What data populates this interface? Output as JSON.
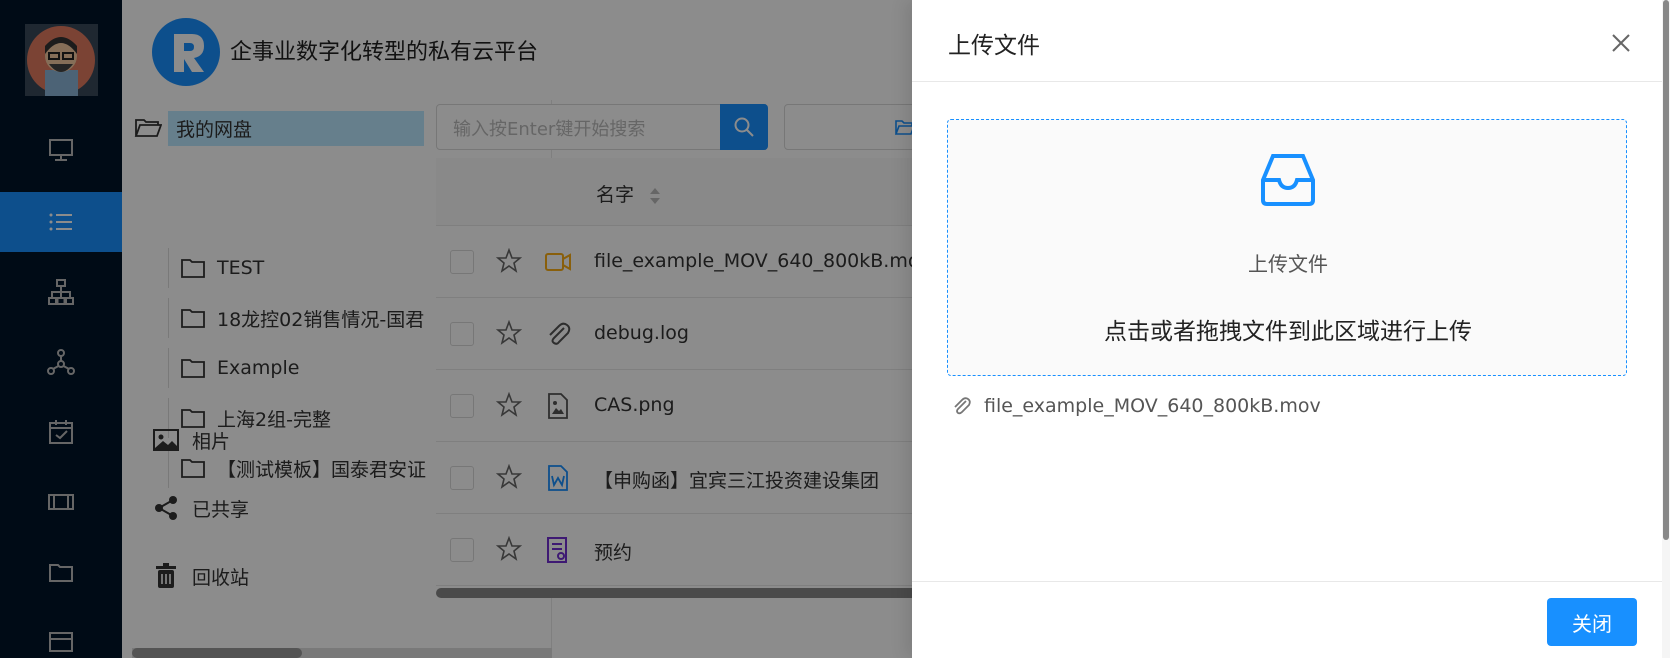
{
  "header": {
    "platform_title": "企事业数字化转型的私有云平台"
  },
  "tree": {
    "root_label": "我的网盘",
    "folders": [
      "TEST",
      "18龙控02销售情况-国君",
      "Example",
      "上海2组-完整",
      "【测试模板】国泰君安证"
    ]
  },
  "side_links": {
    "photos": "相片",
    "shared": "已共享",
    "recycle": "回收站"
  },
  "search": {
    "placeholder": "输入按Enter键开始搜索"
  },
  "table": {
    "name_column": "名字",
    "rows": [
      {
        "name": "file_example_MOV_640_800kB.mov",
        "type": "video"
      },
      {
        "name": "debug.log",
        "type": "attachment"
      },
      {
        "name": "CAS.png",
        "type": "image"
      },
      {
        "name": "【申购函】宜宾三江投资建设集团",
        "type": "word"
      },
      {
        "name": "预约",
        "type": "form"
      }
    ]
  },
  "drawer": {
    "title": "上传文件",
    "dropzone_title": "上传文件",
    "dropzone_hint": "点击或者拖拽文件到此区域进行上传",
    "uploaded_file": "file_example_MOV_640_800kB.mov",
    "close_button": "关闭"
  },
  "colors": {
    "primary": "#1890ff",
    "rail_bg": "#001529",
    "video_icon": "#faad14",
    "form_icon": "#722ed1"
  }
}
